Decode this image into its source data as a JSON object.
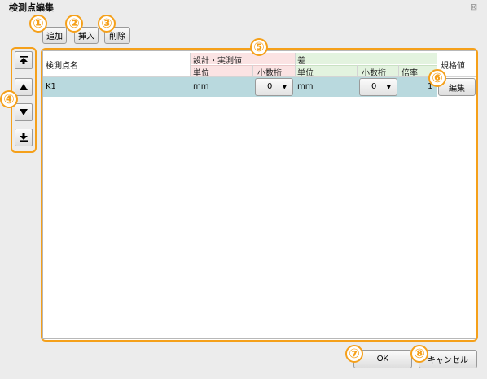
{
  "window": {
    "title": "検測点編集",
    "close_glyph": "⊠"
  },
  "toolbar": {
    "add_label": "追加",
    "insert_label": "挿入",
    "delete_label": "削除"
  },
  "markers": [
    "①",
    "②",
    "③",
    "④",
    "⑤",
    "⑥",
    "⑦",
    "⑧"
  ],
  "move_buttons": [
    {
      "name": "move-top-icon"
    },
    {
      "name": "move-up-icon"
    },
    {
      "name": "move-down-icon"
    },
    {
      "name": "move-bottom-icon"
    }
  ],
  "grid": {
    "headers": {
      "point_name": "検測点名",
      "design_actual": "設計・実測値",
      "diff": "差",
      "spec": "規格値",
      "unit": "単位",
      "decimals": "小数桁",
      "unit2": "単位",
      "decimals2": "小数桁",
      "ratio": "倍率"
    },
    "rows": [
      {
        "name": "K1",
        "unit": "mm",
        "decimals": "0",
        "diff_unit": "mm",
        "diff_decimals": "0",
        "ratio": "1",
        "edit_label": "編集"
      }
    ]
  },
  "footer": {
    "ok_label": "OK",
    "cancel_label": "キャンセル"
  },
  "colors": {
    "accent": "#f5a01a",
    "design_header": "#fbe3e3",
    "diff_header": "#e3f3df",
    "row_selected": "#b9d9de"
  }
}
